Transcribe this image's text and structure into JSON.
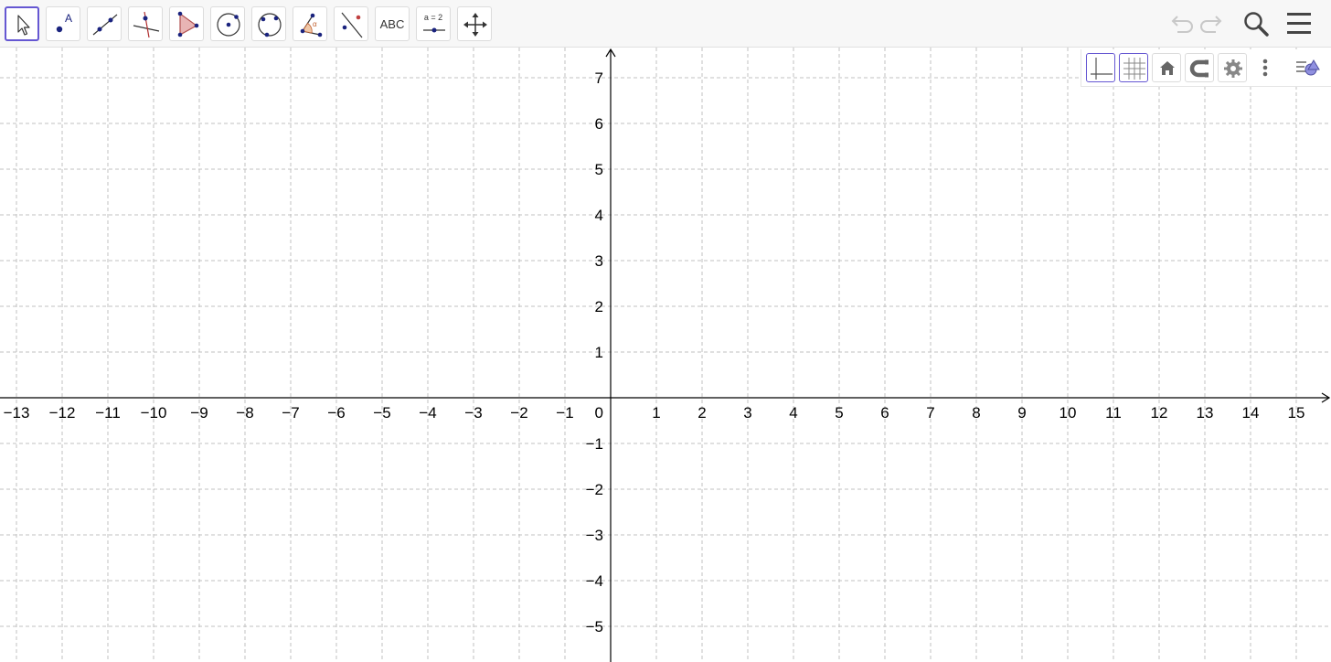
{
  "toolbar": {
    "tools": [
      {
        "name": "move-tool",
        "icon": "arrow-cursor-icon",
        "selected": true
      },
      {
        "name": "point-tool",
        "icon": "point-icon",
        "label": "A"
      },
      {
        "name": "line-tool",
        "icon": "line-icon"
      },
      {
        "name": "perpendicular-line-tool",
        "icon": "perpendicular-line-icon"
      },
      {
        "name": "polygon-tool",
        "icon": "polygon-icon"
      },
      {
        "name": "circle-center-point-tool",
        "icon": "circle-center-icon"
      },
      {
        "name": "circle-three-points-tool",
        "icon": "circle-three-points-icon"
      },
      {
        "name": "angle-tool",
        "icon": "angle-icon",
        "label": "α"
      },
      {
        "name": "reflect-tool",
        "icon": "reflect-icon"
      },
      {
        "name": "text-tool",
        "icon": "text-icon",
        "label": "ABC"
      },
      {
        "name": "slider-tool",
        "icon": "slider-icon",
        "label": "a = 2"
      },
      {
        "name": "move-graphics-view-tool",
        "icon": "move-arrows-icon"
      }
    ],
    "right": [
      {
        "name": "undo-button",
        "icon": "undo-icon",
        "enabled": false
      },
      {
        "name": "redo-button",
        "icon": "redo-icon",
        "enabled": false
      },
      {
        "name": "search-button",
        "icon": "search-icon",
        "enabled": true
      },
      {
        "name": "menu-button",
        "icon": "hamburger-menu-icon",
        "enabled": true
      }
    ]
  },
  "style_bar": {
    "buttons": [
      {
        "name": "toggle-axes-button",
        "icon": "axes-icon",
        "active": true
      },
      {
        "name": "toggle-grid-button",
        "icon": "grid-icon",
        "active": true
      },
      {
        "name": "standard-view-button",
        "icon": "home-icon",
        "active": false
      },
      {
        "name": "point-capturing-button",
        "icon": "magnet-icon",
        "active": false
      },
      {
        "name": "graphics-settings-button",
        "icon": "gear-icon",
        "active": false
      },
      {
        "name": "more-options-button",
        "icon": "kebab-icon",
        "active": false
      },
      {
        "name": "toggle-style-bar-button",
        "icon": "style-bar-icon",
        "active": false
      }
    ]
  },
  "graphics_view": {
    "x_axis": {
      "min": -13,
      "max": 15,
      "step": 1
    },
    "y_axis": {
      "min": -5,
      "max": 7,
      "step": 1
    },
    "origin_label": "0",
    "grid": true,
    "colors": {
      "axis": "#000000",
      "grid": "#c0c0c0",
      "accent": "#6557d2",
      "point": "#1a237e"
    }
  }
}
